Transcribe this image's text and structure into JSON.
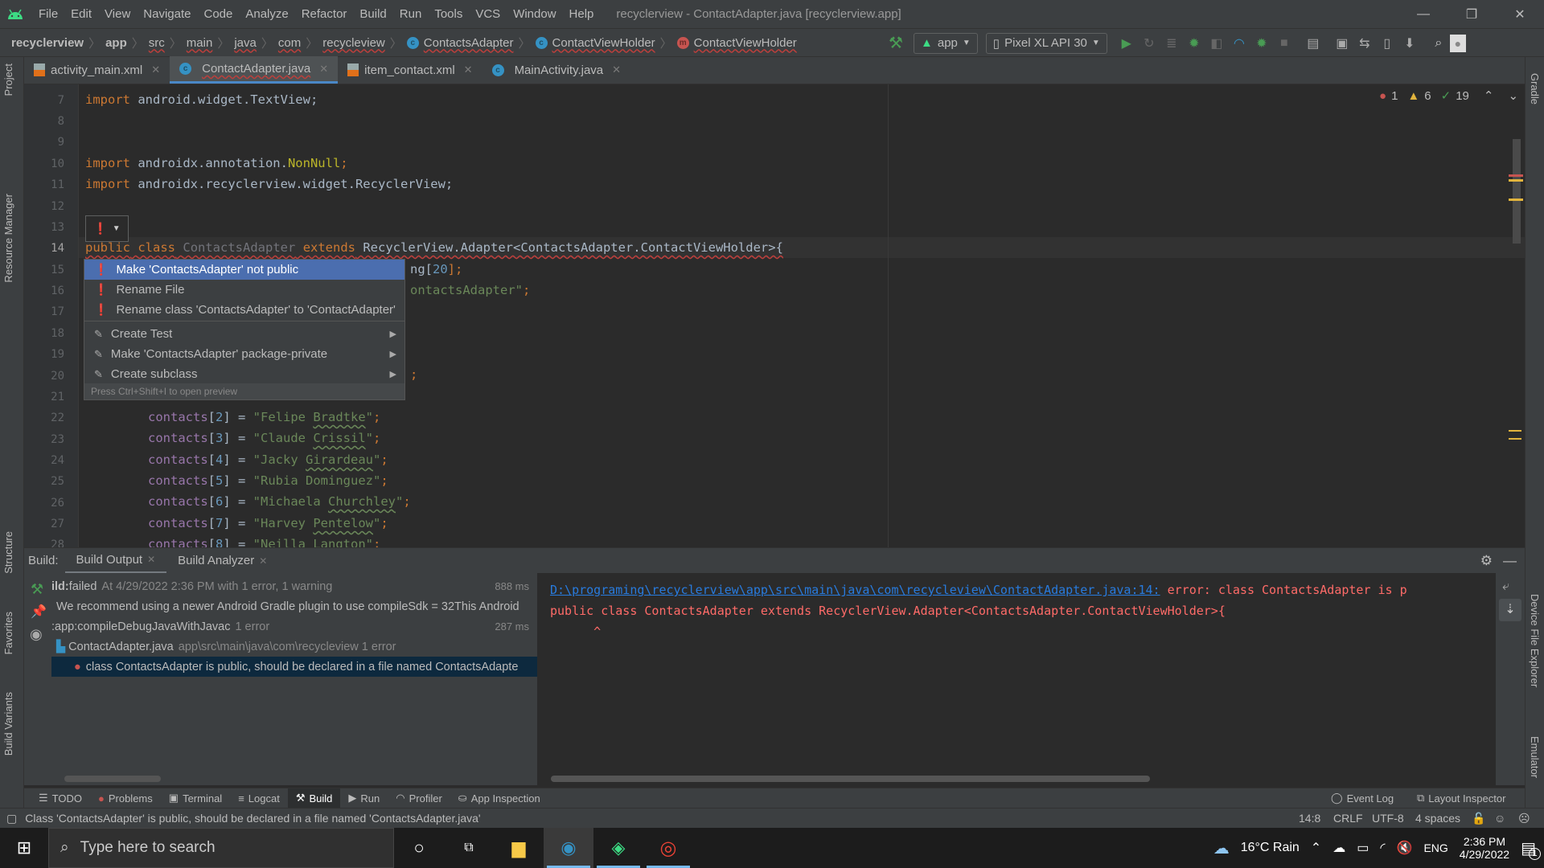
{
  "titlebar": {
    "menus": [
      "File",
      "Edit",
      "View",
      "Navigate",
      "Code",
      "Analyze",
      "Refactor",
      "Build",
      "Run",
      "Tools",
      "VCS",
      "Window",
      "Help"
    ],
    "window_title": "recyclerview - ContactAdapter.java [recyclerview.app]",
    "minimize": "—",
    "restore": "❐",
    "close": "✕"
  },
  "navbar": {
    "breadcrumbs": [
      {
        "label": "recyclerview",
        "icon": ""
      },
      {
        "label": "app",
        "icon": ""
      },
      {
        "label": "src",
        "icon": ""
      },
      {
        "label": "main",
        "icon": ""
      },
      {
        "label": "java",
        "icon": ""
      },
      {
        "label": "com",
        "icon": ""
      },
      {
        "label": "recycleview",
        "icon": ""
      },
      {
        "label": "ContactsAdapter",
        "icon": "class-icon"
      },
      {
        "label": "ContactViewHolder",
        "icon": "class-icon"
      },
      {
        "label": "ContactViewHolder",
        "icon": "method-icon"
      }
    ],
    "run_config": "app",
    "device": "Pixel XL API 30"
  },
  "tabs": [
    {
      "label": "activity_main.xml",
      "icon": "xml-file-icon",
      "active": false
    },
    {
      "label": "ContactAdapter.java",
      "icon": "class-icon",
      "active": true
    },
    {
      "label": "item_contact.xml",
      "icon": "xml-file-icon",
      "active": false
    },
    {
      "label": "MainActivity.java",
      "icon": "class-icon",
      "active": false
    }
  ],
  "side_tools_left": [
    "Project",
    "Resource Manager",
    "Structure",
    "Favorites",
    "Build Variants"
  ],
  "side_tools_right": [
    "Gradle",
    "Device File Explorer",
    "Emulator"
  ],
  "inspection": {
    "errors": "1",
    "warnings": "6",
    "typos": "19"
  },
  "editor": {
    "line_numbers": [
      "7",
      "8",
      "9",
      "10",
      "11",
      "12",
      "13",
      "14",
      "15",
      "16",
      "17",
      "18",
      "19",
      "20",
      "21",
      "22",
      "23",
      "24",
      "25",
      "26",
      "27",
      "28"
    ],
    "line7": {
      "kw": "import",
      "rest": " android.widget.TextView;"
    },
    "line10": {
      "kw": "import",
      "rest": " androidx.annotation.",
      "ann": "NonNull",
      ";": ";"
    },
    "line11": {
      "kw": "import",
      "rest": " androidx.recyclerview.widget.RecyclerView;"
    },
    "line14": {
      "kw1": "public",
      "kw2": "class",
      "name": "ContactsAdapter",
      "kw3": "extends",
      "rest": " RecyclerView.Adapter<ContactsAdapter.ContactViewHolder>{"
    },
    "line15_tail": {
      "t": "ng[",
      "n": "20",
      "e": "];"
    },
    "line16_tail": {
      "s": "ontactsAdapter\"",
      "e": ";"
    },
    "line20_tail": ";",
    "contacts": [
      {
        "idx": "2",
        "first": "Felipe ",
        "last": "Bradtke"
      },
      {
        "idx": "3",
        "first": "Claude ",
        "last": "Crissil"
      },
      {
        "idx": "4",
        "first": "Jacky ",
        "last": "Girardeau"
      },
      {
        "idx": "5",
        "first": "Rubia Dominguez",
        "last": ""
      },
      {
        "idx": "6",
        "first": "Michaela ",
        "last": "Churchley"
      },
      {
        "idx": "7",
        "first": "Harvey ",
        "last": "Pentelow"
      },
      {
        "idx": "8",
        "first": "Neilla ",
        "last": "Langton"
      }
    ],
    "contacts_var": "contacts"
  },
  "popup": {
    "items": [
      {
        "label": "Make 'ContactsAdapter' not public",
        "icon": "error-bulb-icon",
        "selected": true
      },
      {
        "label": "Rename File",
        "icon": "error-bulb-icon",
        "selected": false
      },
      {
        "label": "Rename class 'ContactsAdapter' to 'ContactAdapter'",
        "icon": "error-bulb-icon",
        "selected": false
      }
    ],
    "intentions": [
      {
        "label": "Create Test",
        "icon": "intention-icon"
      },
      {
        "label": "Make 'ContactsAdapter' package-private",
        "icon": "intention-icon"
      },
      {
        "label": "Create subclass",
        "icon": "intention-icon"
      }
    ],
    "hint": "Press Ctrl+Shift+I to open preview"
  },
  "build": {
    "label": "Build:",
    "tabs": [
      "Build Output",
      "Build Analyzer"
    ],
    "tree": [
      {
        "bold": "ild:",
        "text": " failed",
        "dim": "At 4/29/2022 2:36 PM with 1 error, 1 warning",
        "time": "888 ms"
      },
      {
        "text": "We recommend using a newer Android Gradle plugin to use compileSdk = 32This Android",
        "dim": "",
        "time": ""
      },
      {
        "text": ":app:compileDebugJavaWithJavac",
        "dim": "1 error",
        "time": "287 ms"
      },
      {
        "text": "ContactAdapter.java",
        "dim": "app\\src\\main\\java\\com\\recycleview 1 error",
        "time": ""
      },
      {
        "text": "class ContactsAdapter is public, should be declared in a file named ContactsAdapte",
        "dim": "",
        "time": ""
      }
    ],
    "console": {
      "link": "D:\\programing\\recyclerview\\app\\src\\main\\java\\com\\recycleview\\ContactAdapter.java:14:",
      "error": " error: class ContactsAdapter is p",
      "line2": "public class ContactsAdapter extends RecyclerView.Adapter<ContactsAdapter.ContactViewHolder>{",
      "caret": "      ^"
    }
  },
  "tool_tabs": [
    {
      "label": "TODO",
      "icon": "list-icon",
      "active": false
    },
    {
      "label": "Problems",
      "icon": "error-icon",
      "active": false
    },
    {
      "label": "Terminal",
      "icon": "terminal-icon",
      "active": false
    },
    {
      "label": "Logcat",
      "icon": "logcat-icon",
      "active": false
    },
    {
      "label": "Build",
      "icon": "hammer-icon",
      "active": true
    },
    {
      "label": "Run",
      "icon": "run-icon",
      "active": false
    },
    {
      "label": "Profiler",
      "icon": "profiler-icon",
      "active": false
    },
    {
      "label": "App Inspection",
      "icon": "app-inspection-icon",
      "active": false
    }
  ],
  "tool_tabs_right": [
    "Event Log",
    "Layout Inspector"
  ],
  "status": {
    "message": "Class 'ContactsAdapter' is public, should be declared in a file named 'ContactsAdapter.java'",
    "position": "14:8",
    "line_sep": "CRLF",
    "encoding": "UTF-8",
    "indent": "4 spaces"
  },
  "taskbar": {
    "search_placeholder": "Type here to search",
    "weather": "16°C  Rain",
    "lang": "ENG",
    "time": "2:36 PM",
    "date": "4/29/2022",
    "notifications": "1"
  },
  "colors": {
    "accent": "#4b6eaf",
    "error": "#c75450",
    "warning": "#e2b43d",
    "success": "#499c54"
  }
}
